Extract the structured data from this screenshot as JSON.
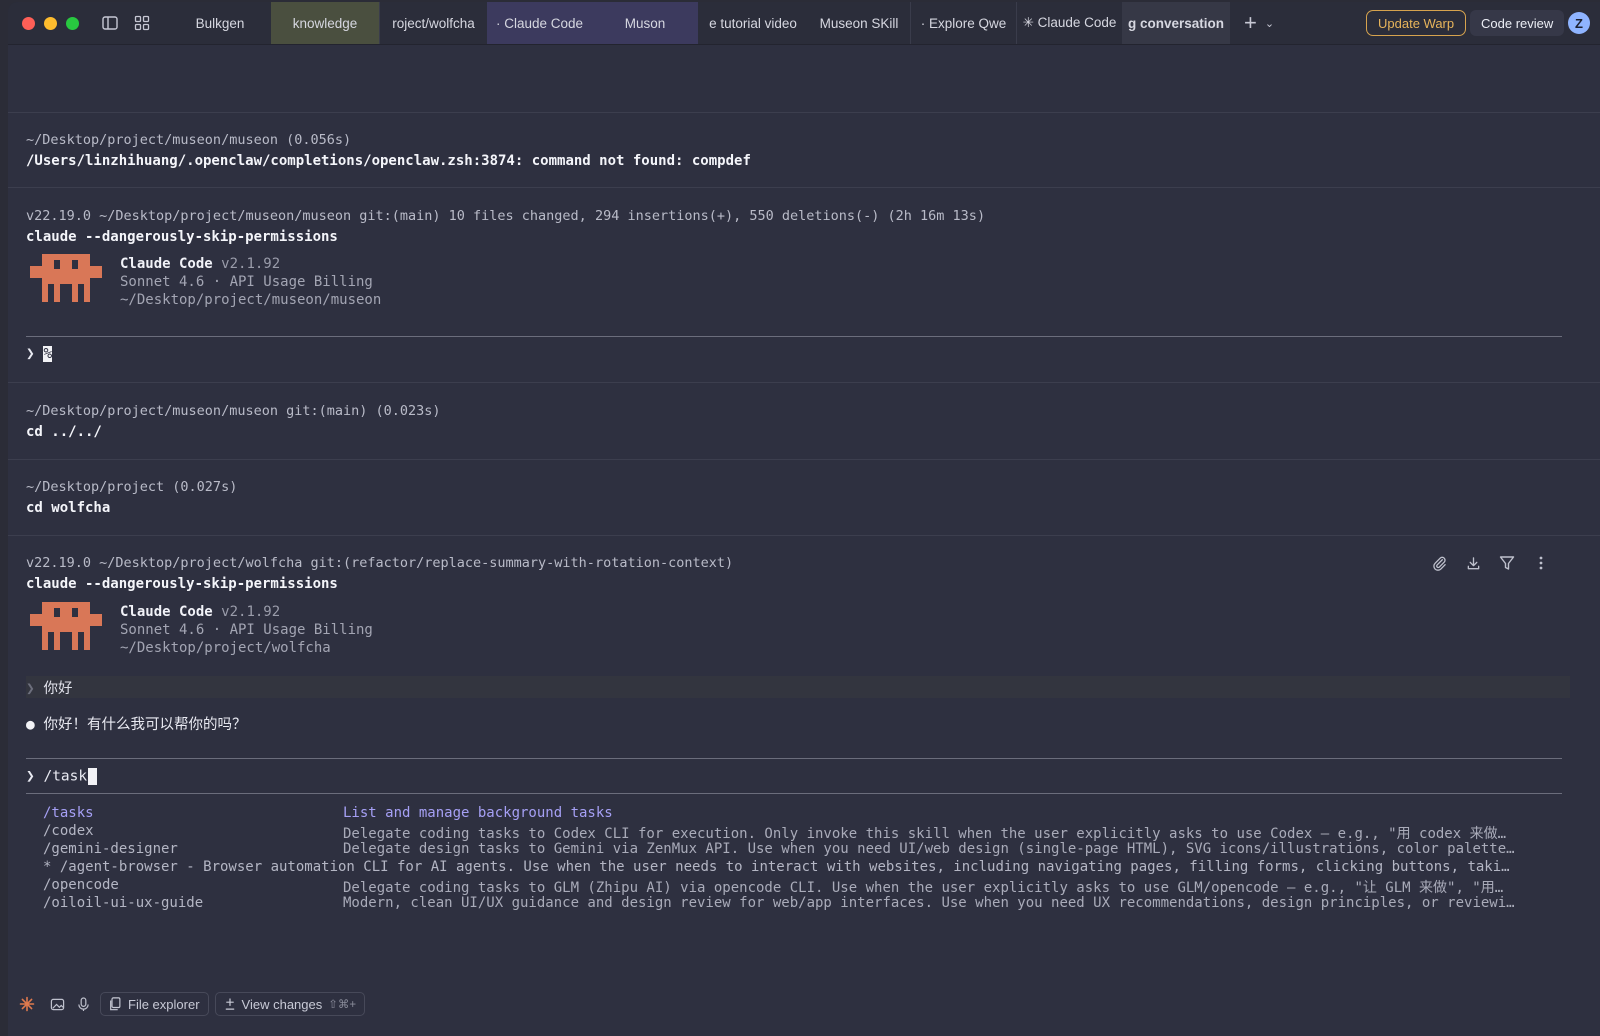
{
  "titlebar": {
    "tabs": [
      {
        "label": "Bulkgen"
      },
      {
        "label": "knowledge"
      },
      {
        "label": "roject/wolfcha"
      },
      {
        "label": "· Claude Code"
      },
      {
        "label": "Muson"
      },
      {
        "label": "e tutorial video"
      },
      {
        "label": "Museon SKill"
      },
      {
        "label": "· Explore Qwe"
      },
      {
        "label": "✳ Claude Code"
      },
      {
        "label": "g conversation"
      }
    ],
    "update_label": "Update Warp",
    "review_label": "Code review",
    "avatar_letter": "Z"
  },
  "blocks": {
    "b1": {
      "meta": "~/Desktop/project/museon/museon (0.056s)",
      "output": "/Users/linzhihuang/.openclaw/completions/openclaw.zsh:3874: command not found: compdef"
    },
    "b2": {
      "meta": "v22.19.0 ~/Desktop/project/museon/museon git:(main)  10 files changed, 294 insertions(+), 550 deletions(-) (2h 16m 13s)",
      "cmd": "claude --dangerously-skip-permissions",
      "cc_name": "Claude Code",
      "cc_version": "v2.1.92",
      "cc_model": "Sonnet 4.6 · API Usage Billing",
      "cc_path": "~/Desktop/project/museon/museon",
      "prompt_symbol": "❯",
      "prompt_text": "%"
    },
    "b3": {
      "meta": "~/Desktop/project/museon/museon git:(main) (0.023s)",
      "cmd": "cd ../../"
    },
    "b4": {
      "meta": "~/Desktop/project (0.027s)",
      "cmd": "cd wolfcha"
    },
    "b5": {
      "meta": "v22.19.0 ~/Desktop/project/wolfcha git:(refactor/replace-summary-with-rotation-context)",
      "cmd": "claude --dangerously-skip-permissions",
      "cc_name": "Claude Code",
      "cc_version": "v2.1.92",
      "cc_model": "Sonnet 4.6 · API Usage Billing",
      "cc_path": "~/Desktop/project/wolfcha",
      "user_msg_symbol": "❯",
      "user_msg": "你好",
      "reply_bullet": "●",
      "reply": "你好！有什么我可以帮你的吗？",
      "input_symbol": "❯",
      "input_value": "/task"
    }
  },
  "suggestions": [
    {
      "cmd": "/tasks",
      "desc": "List and manage background tasks"
    },
    {
      "cmd": "/codex",
      "desc": "Delegate coding tasks to Codex CLI for execution. Only invoke this skill when the user explicitly asks to use Codex — e.g., \"用 codex 来做…"
    },
    {
      "cmd": "/gemini-designer",
      "desc": "Delegate design tasks to Gemini via ZenMux API. Use when you need UI/web design (single-page HTML), SVG icons/illustrations, color palette…"
    },
    {
      "cmd": "* /agent-browser - Browser automation CLI for AI agents. Use when the user needs to interact with websites, including navigating pages, filling forms, clicking buttons, taki…",
      "desc": ""
    },
    {
      "cmd": "/opencode",
      "desc": "Delegate coding tasks to GLM (Zhipu AI) via opencode CLI. Use when the user explicitly asks to use GLM/opencode — e.g., \"让 GLM 来做\", \"用…"
    },
    {
      "cmd": "/oiloil-ui-ux-guide",
      "desc": "Modern, clean UI/UX guidance and design review for web/app interfaces. Use when you need UX recommendations, design principles, or reviewi…"
    }
  ],
  "footer": {
    "file_explorer_label": "File explorer",
    "view_changes_label": "View changes",
    "view_changes_shortcut": "⇧⌘+"
  },
  "colors": {
    "accent_orange": "#d97757",
    "suggestion_active": "#a6a0f5",
    "update_warp": "#e7b45b"
  }
}
